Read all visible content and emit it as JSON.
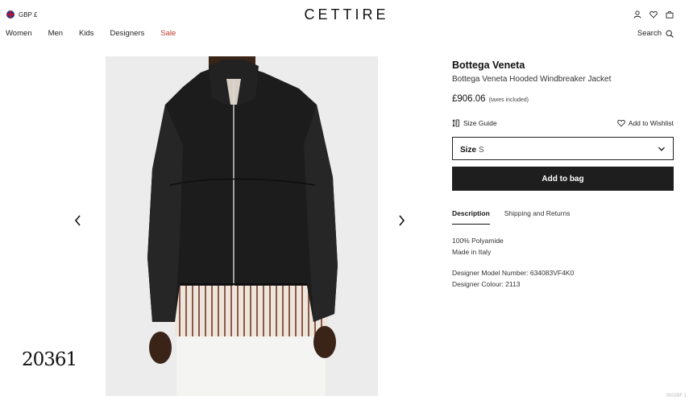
{
  "header": {
    "currency": "GBP £",
    "logo": "CETTIRE",
    "nav": [
      "Women",
      "Men",
      "Kids",
      "Designers",
      "Sale"
    ],
    "search_label": "Search",
    "icons": [
      "account-icon",
      "wishlist-heart-icon",
      "bag-icon"
    ]
  },
  "gallery": {
    "prev_icon": "chevron-left-icon",
    "next_icon": "chevron-right-icon"
  },
  "product": {
    "brand": "Bottega Veneta",
    "name": "Bottega Veneta Hooded Windbreaker Jacket",
    "price": "£906.06",
    "tax_note": "(taxes included)",
    "size_guide": "Size Guide",
    "wishlist": "Add to Wishlist",
    "size_label": "Size",
    "size_value": "S",
    "add_to_bag": "Add to bag",
    "tabs": [
      "Description",
      "Shipping and Returns"
    ],
    "details": {
      "material": "100% Polyamide",
      "origin": "Made in Italy",
      "model_number": "Designer Model Number: 634083VF4K0",
      "colour": "Designer Colour: 2113"
    }
  },
  "watermark": "20361",
  "corner_mark": "00029F 1",
  "colors": {
    "sale": "#c0392b",
    "button_bg": "#1e1e1e",
    "image_bg": "#ececec"
  }
}
